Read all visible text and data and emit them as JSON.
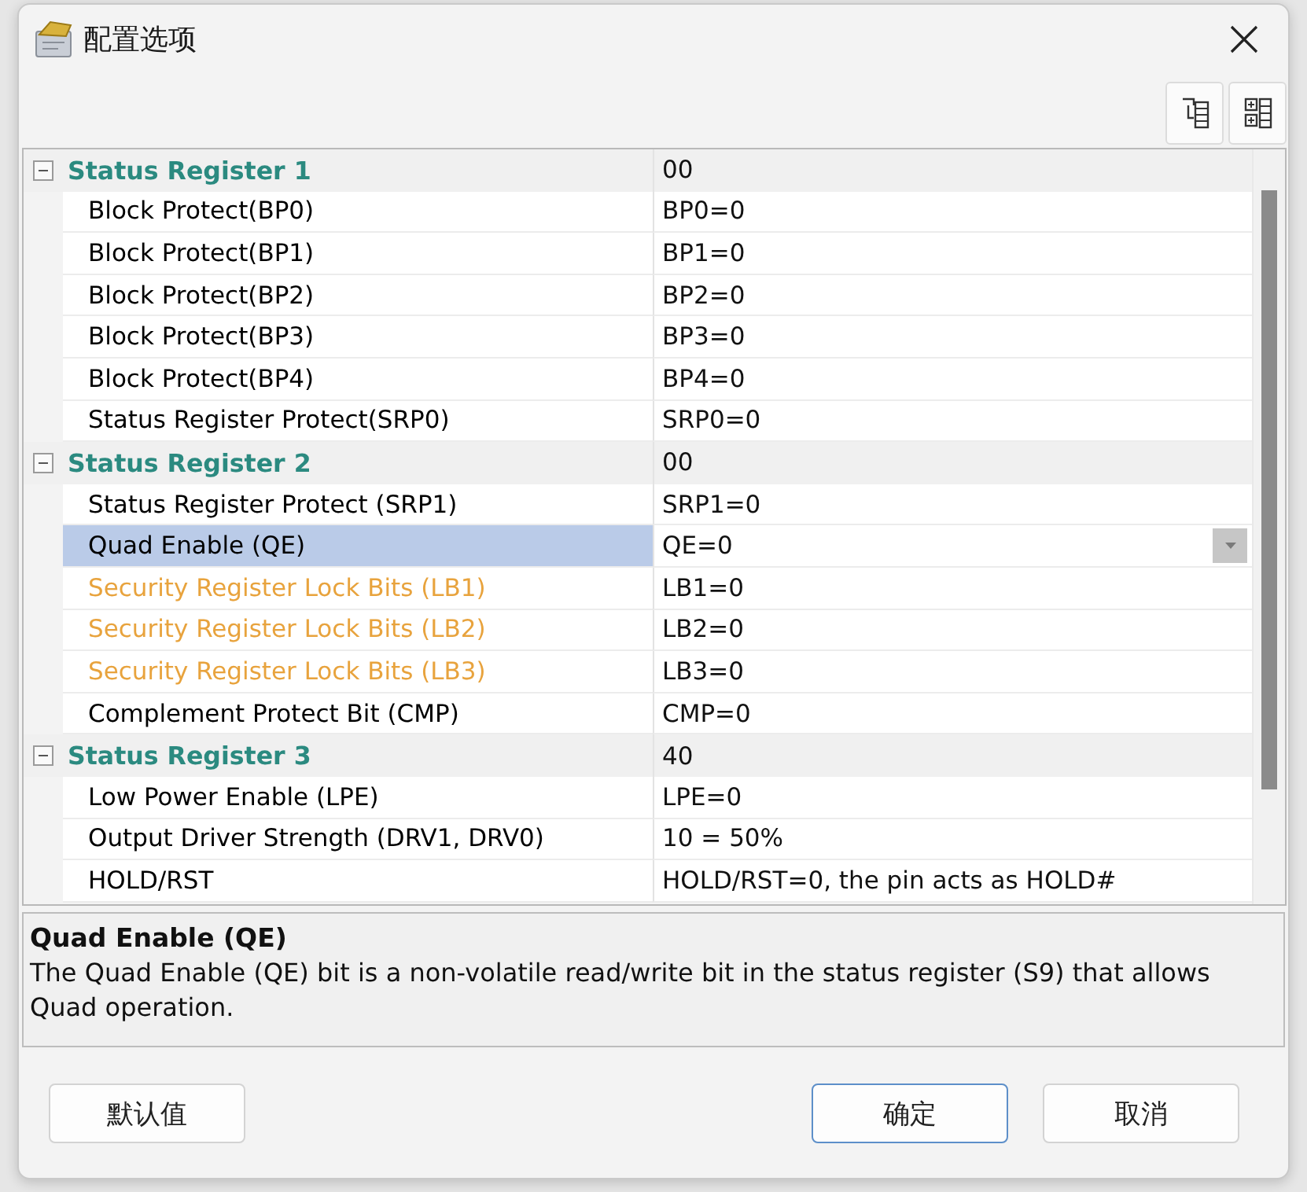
{
  "window": {
    "title": "配置选项"
  },
  "properties": {
    "groups": [
      {
        "name": "Status Register 1",
        "value": "00",
        "expanded": true,
        "items": [
          {
            "name": "Block Protect(BP0)",
            "value": "BP0=0",
            "color": "#000000",
            "selected": false
          },
          {
            "name": "Block Protect(BP1)",
            "value": "BP1=0",
            "color": "#000000",
            "selected": false
          },
          {
            "name": "Block Protect(BP2)",
            "value": "BP2=0",
            "color": "#000000",
            "selected": false
          },
          {
            "name": "Block Protect(BP3)",
            "value": "BP3=0",
            "color": "#000000",
            "selected": false
          },
          {
            "name": "Block Protect(BP4)",
            "value": "BP4=0",
            "color": "#000000",
            "selected": false
          },
          {
            "name": "Status Register Protect(SRP0)",
            "value": "SRP0=0",
            "color": "#000000",
            "selected": false
          }
        ]
      },
      {
        "name": "Status Register 2",
        "value": "00",
        "expanded": true,
        "items": [
          {
            "name": "Status Register Protect (SRP1)",
            "value": "SRP1=0",
            "color": "#000000",
            "selected": false
          },
          {
            "name": "Quad Enable (QE)",
            "value": "QE=0",
            "color": "#000000",
            "selected": true
          },
          {
            "name": "Security Register Lock Bits (LB1)",
            "value": "LB1=0",
            "color": "#e8a33d",
            "selected": false
          },
          {
            "name": "Security Register Lock Bits (LB2)",
            "value": "LB2=0",
            "color": "#e8a33d",
            "selected": false
          },
          {
            "name": "Security Register Lock Bits (LB3)",
            "value": "LB3=0",
            "color": "#e8a33d",
            "selected": false
          },
          {
            "name": "Complement Protect Bit (CMP)",
            "value": "CMP=0",
            "color": "#000000",
            "selected": false
          }
        ]
      },
      {
        "name": "Status Register 3",
        "value": "40",
        "expanded": true,
        "items": [
          {
            "name": "Low Power Enable (LPE)",
            "value": "LPE=0",
            "color": "#000000",
            "selected": false
          },
          {
            "name": "Output Driver Strength (DRV1, DRV0)",
            "value": "10 = 50%",
            "color": "#000000",
            "selected": false
          },
          {
            "name": "HOLD/RST",
            "value": "HOLD/RST=0, the pin acts as HOLD#",
            "color": "#000000",
            "selected": false
          }
        ]
      }
    ]
  },
  "description": {
    "title": "Quad Enable (QE)",
    "text": "The Quad Enable (QE) bit is a non-volatile read/write bit in the status register (S9) that allows Quad operation."
  },
  "buttons": [
    {
      "label": "默认值",
      "default": false
    },
    {
      "label": "确定",
      "default": true
    },
    {
      "label": "取消",
      "default": false
    }
  ]
}
